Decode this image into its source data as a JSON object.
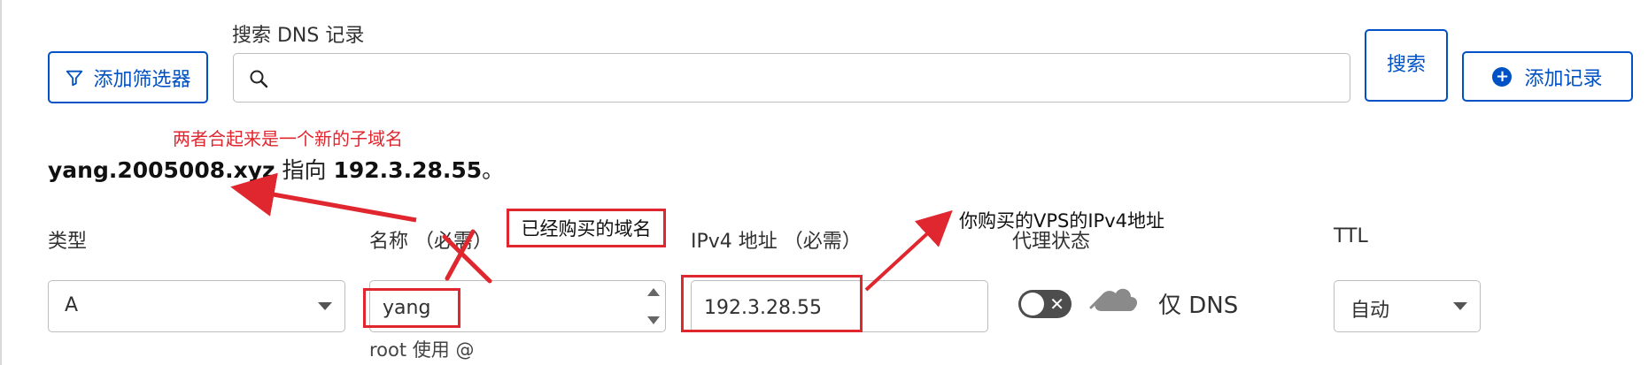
{
  "toolbar": {
    "filter_label": "添加筛选器",
    "search_label": "搜索 DNS 记录",
    "search_value": "",
    "search_button": "搜索",
    "add_record_label": "添加记录"
  },
  "annotations": {
    "combined_note": "两者合起来是一个新的子域名",
    "domain_note": "已经购买的域名",
    "vps_note": "你购买的VPS的IPv4地址"
  },
  "preview": {
    "host": "yang.2005008.xyz",
    "points_to": " 指向 ",
    "target": "192.3.28.55",
    "end": "。"
  },
  "form": {
    "type_label": "类型",
    "type_value": "A",
    "name_label": "名称 （必需）",
    "name_value": "yang",
    "name_hint": "root 使用 @",
    "ipv4_label": "IPv4 地址 （必需）",
    "ipv4_value": "192.3.28.55",
    "proxy_label": "代理状态",
    "proxy_status": "仅 DNS",
    "proxy_enabled": false,
    "ttl_label": "TTL",
    "ttl_value": "自动"
  },
  "icons": {
    "filter": "filter-icon",
    "search": "search-icon",
    "add": "plus-circle-icon",
    "cloud": "cloud-icon",
    "select_caret": "chevron-down-icon"
  },
  "colors": {
    "accent": "#0051c3",
    "annotation": "#e0262e",
    "cloud": "#8a8a8a"
  }
}
